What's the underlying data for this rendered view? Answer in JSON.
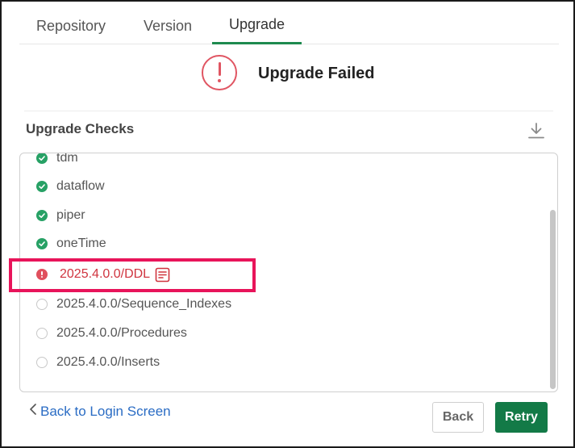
{
  "tabs": [
    {
      "label": "Repository"
    },
    {
      "label": "Version"
    },
    {
      "label": "Upgrade"
    }
  ],
  "status": {
    "title": "Upgrade Failed",
    "icon": "exclamation-circle-icon",
    "color": "#e05562"
  },
  "section": {
    "title": "Upgrade Checks",
    "download_icon": "download-icon"
  },
  "checks": [
    {
      "label": "tdm",
      "state": "success"
    },
    {
      "label": "dataflow",
      "state": "success"
    },
    {
      "label": "piper",
      "state": "success"
    },
    {
      "label": "oneTime",
      "state": "success"
    },
    {
      "label": "2025.4.0.0/DDL",
      "state": "failed"
    },
    {
      "label": "2025.4.0.0/Sequence_Indexes",
      "state": "pending"
    },
    {
      "label": "2025.4.0.0/Procedures",
      "state": "pending"
    },
    {
      "label": "2025.4.0.0/Inserts",
      "state": "pending"
    }
  ],
  "footer": {
    "back_link": "Back to Login Screen",
    "back_button": "Back",
    "retry_button": "Retry"
  },
  "colors": {
    "accent": "#1e8a4f",
    "retry": "#137a47",
    "error": "#d0343f",
    "success": "#27a165",
    "link": "#2a6cc4",
    "highlight": "#e8145a"
  }
}
